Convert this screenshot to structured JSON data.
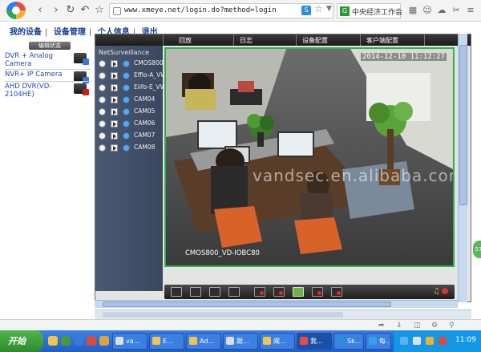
{
  "browser": {
    "url": "www.xmeye.net/login.do?method=login",
    "search_text": "中央经济工作会",
    "search_badge": "G",
    "ext_badge": "S"
  },
  "site_nav": {
    "items": [
      "我的设备",
      "设备管理",
      "个人信息",
      "退出"
    ],
    "separator": "|"
  },
  "device_panel": {
    "header": "编辑状态",
    "devices": [
      {
        "label": "DVR + Analog Camera",
        "status": "online"
      },
      {
        "label": "NVR+ IP Camera",
        "status": "online"
      },
      {
        "label": "AHD DVR(VD-2104HE)",
        "status": "error"
      }
    ]
  },
  "tabs": [
    "回放",
    "日志",
    "设备配置",
    "客户端配置"
  ],
  "tree": {
    "root": "NetSurveillance",
    "cameras": [
      "CMOS800_",
      "Effio-A_VW",
      "Eiifo-E_VW",
      "CAM04",
      "CAM05",
      "CAM06",
      "CAM07",
      "CAM08"
    ]
  },
  "video": {
    "timestamp": "2014-12-10 11:12:27",
    "camera_name": "CMOS800_VD-IOBC80",
    "watermark": "vandsec.en.alibaba.com"
  },
  "taskbar": {
    "start_label": "开始",
    "tasks": [
      "va...",
      "E...",
      "Ad...",
      "跟...",
      "闽...",
      "我...",
      "Sk...",
      "每..."
    ],
    "clock": "11:09"
  },
  "side_button": "57",
  "colors": {
    "video_border": "#29b24a",
    "tab_bar": "#1b1b1b",
    "nav_text": "#123a8c",
    "device_text": "#2348a8",
    "taskbar": "#1f5fc5",
    "start": "#2f8a2c"
  }
}
